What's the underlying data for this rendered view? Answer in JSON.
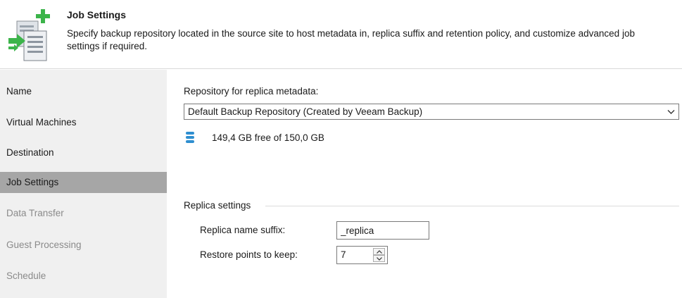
{
  "header": {
    "title": "Job Settings",
    "description": "Specify backup repository located in the source site to host metadata in, replica suffix and retention policy, and customize advanced job settings if required.",
    "icon": "job-settings-wizard-icon"
  },
  "sidebar": {
    "items": [
      {
        "label": "Name",
        "state": "normal"
      },
      {
        "label": "Virtual Machines",
        "state": "normal"
      },
      {
        "label": "Destination",
        "state": "normal"
      },
      {
        "label": "Job Settings",
        "state": "active"
      },
      {
        "label": "Data Transfer",
        "state": "disabled"
      },
      {
        "label": "Guest Processing",
        "state": "disabled"
      },
      {
        "label": "Schedule",
        "state": "disabled"
      }
    ]
  },
  "repository": {
    "label": "Repository for replica metadata:",
    "selected": "Default Backup Repository (Created by Veeam Backup)",
    "free_space": "149,4 GB free of 150,0 GB",
    "icon": "database-icon"
  },
  "replica": {
    "group_label": "Replica settings",
    "suffix_label": "Replica name suffix:",
    "suffix_value": "_replica",
    "restore_label": "Restore points to keep:",
    "restore_value": "7"
  },
  "colors": {
    "active_nav_bg": "#a6a6a6",
    "sidebar_bg": "#f0f0f0",
    "disabled_text": "#8a8a8a",
    "icon_green": "#3cb44a",
    "icon_blue": "#2f8fd0"
  }
}
